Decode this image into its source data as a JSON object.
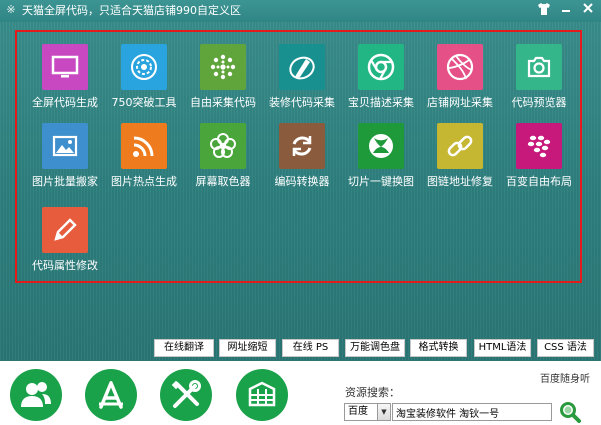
{
  "window": {
    "logo_icon": "app-logo-icon",
    "title": "天猫全屏代码，只适合天猫店铺990自定义区",
    "skin_icon": "shirt-icon",
    "minimize_icon": "minimize-icon",
    "close_icon": "close-icon"
  },
  "tools": [
    {
      "label": "全屏代码生成",
      "icon": "monitor-icon",
      "color": "#c848c1"
    },
    {
      "label": "750突破工具",
      "icon": "lens-circle-icon",
      "color": "#2aa4de"
    },
    {
      "label": "自由采集代码",
      "icon": "dots-ring-icon",
      "color": "#5fa53b"
    },
    {
      "label": "装修代码采集",
      "icon": "pen-swirl-icon",
      "color": "#17908f"
    },
    {
      "label": "宝贝描述采集",
      "icon": "chrome-icon",
      "color": "#22b685"
    },
    {
      "label": "店铺网址采集",
      "icon": "dribbble-icon",
      "color": "#e55187"
    },
    {
      "label": "代码预览器",
      "icon": "camera-icon",
      "color": "#34b68a"
    },
    {
      "label": "图片批量搬家",
      "icon": "picture-icon",
      "color": "#3e8fcd"
    },
    {
      "label": "图片热点生成",
      "icon": "rss-icon",
      "color": "#ee7b1d"
    },
    {
      "label": "屏幕取色器",
      "icon": "flower-icon",
      "color": "#4aa53a"
    },
    {
      "label": "编码转换器",
      "icon": "refresh-icon",
      "color": "#8a5b3d"
    },
    {
      "label": "切片一键换图",
      "icon": "xbox-icon",
      "color": "#1f9a3b"
    },
    {
      "label": "图链地址修复",
      "icon": "chain-link-icon",
      "color": "#c6b732"
    },
    {
      "label": "百变自由布局",
      "icon": "blackberry-icon",
      "color": "#c7187c"
    },
    {
      "label": "代码属性修改",
      "icon": "pencil-icon",
      "color": "#e65c3d"
    }
  ],
  "utility_buttons": [
    {
      "label": "在线翻译"
    },
    {
      "label": "网址缩短"
    },
    {
      "label": "在线 PS"
    },
    {
      "label": "万能调色盘"
    },
    {
      "label": "格式转换"
    },
    {
      "label": "HTML语法"
    },
    {
      "label": "CSS 语法"
    }
  ],
  "bottom": {
    "big_icons": [
      {
        "icon": "users-icon"
      },
      {
        "icon": "app-store-icon"
      },
      {
        "icon": "tools-icon"
      },
      {
        "icon": "cabinet-icon"
      }
    ],
    "resource_label": "资源搜索：",
    "baidu_link": "百度随身听",
    "engine_selected": "百度",
    "search_value": "淘宝装修软件 淘钬一号",
    "search_icon": "magnifier-icon",
    "brand_color": "#1aa24a"
  }
}
